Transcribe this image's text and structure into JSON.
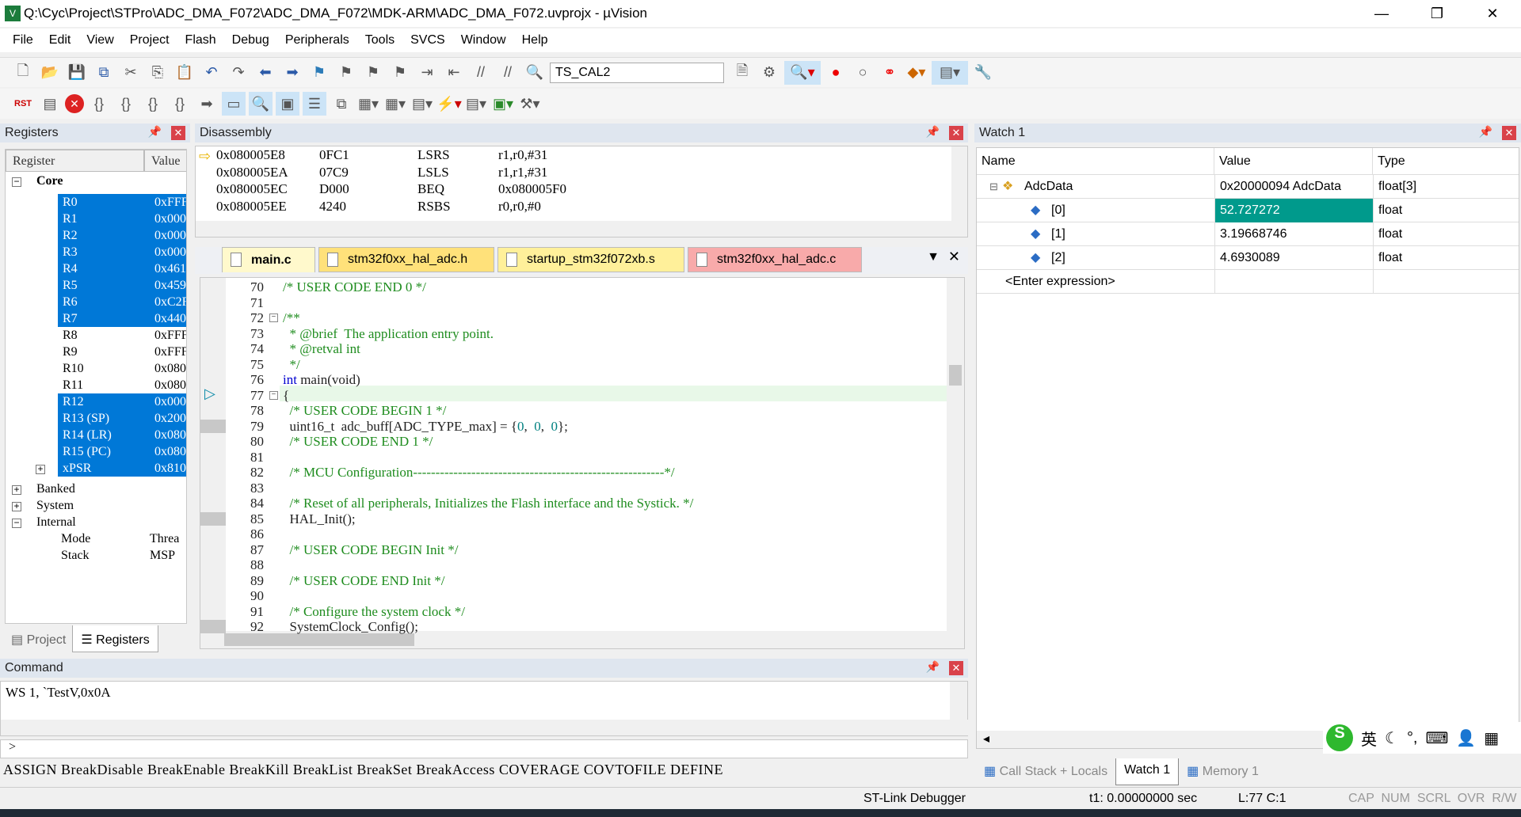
{
  "window": {
    "title": "Q:\\Cyc\\Project\\STPro\\ADC_DMA_F072\\ADC_DMA_F072\\MDK-ARM\\ADC_DMA_F072.uvprojx - µVision",
    "minimize": "—",
    "maximize": "❐",
    "close": "✕"
  },
  "menu": [
    "File",
    "Edit",
    "View",
    "Project",
    "Flash",
    "Debug",
    "Peripherals",
    "Tools",
    "SVCS",
    "Window",
    "Help"
  ],
  "toolbar": {
    "target": "TS_CAL2"
  },
  "registers": {
    "title": "Registers",
    "col_register": "Register",
    "col_value": "Value",
    "core": "Core",
    "rows": [
      {
        "name": "R0",
        "value": "0xFFF",
        "sel": true
      },
      {
        "name": "R1",
        "value": "0x000",
        "sel": true
      },
      {
        "name": "R2",
        "value": "0x000",
        "sel": true
      },
      {
        "name": "R3",
        "value": "0x000",
        "sel": true
      },
      {
        "name": "R4",
        "value": "0x461",
        "sel": true
      },
      {
        "name": "R5",
        "value": "0x459",
        "sel": true
      },
      {
        "name": "R6",
        "value": "0xC2F",
        "sel": true
      },
      {
        "name": "R7",
        "value": "0x440",
        "sel": true
      },
      {
        "name": "R8",
        "value": "0xFFF",
        "sel": false
      },
      {
        "name": "R9",
        "value": "0xFFF",
        "sel": false
      },
      {
        "name": "R10",
        "value": "0x080",
        "sel": false
      },
      {
        "name": "R11",
        "value": "0x080",
        "sel": false
      },
      {
        "name": "R12",
        "value": "0x000",
        "sel": true
      },
      {
        "name": "R13 (SP)",
        "value": "0x200",
        "sel": true
      },
      {
        "name": "R14 (LR)",
        "value": "0x080",
        "sel": true
      },
      {
        "name": "R15 (PC)",
        "value": "0x080",
        "sel": true
      },
      {
        "name": "xPSR",
        "value": "0x810",
        "sel": true
      }
    ],
    "groups": [
      "Banked",
      "System",
      "Internal"
    ],
    "internal": [
      {
        "name": "Mode",
        "value": "Threa"
      },
      {
        "name": "Stack",
        "value": "MSP"
      }
    ],
    "tab_project": "Project",
    "tab_registers": "Registers"
  },
  "disassembly": {
    "title": "Disassembly",
    "rows": [
      {
        "addr": "0x080005E8",
        "op": "0FC1",
        "mn": "LSRS",
        "args": "r1,r0,#31"
      },
      {
        "addr": "0x080005EA",
        "op": "07C9",
        "mn": "LSLS",
        "args": "r1,r1,#31"
      },
      {
        "addr": "0x080005EC",
        "op": "D000",
        "mn": "BEQ",
        "args": "0x080005F0"
      },
      {
        "addr": "0x080005EE",
        "op": "4240",
        "mn": "RSBS",
        "args": "r0,r0,#0"
      }
    ]
  },
  "editor": {
    "tabs": [
      {
        "label": "main.c",
        "bg": "#fff9cc"
      },
      {
        "label": "stm32f0xx_hal_adc.h",
        "bg": "#ffe17a"
      },
      {
        "label": "startup_stm32f072xb.s",
        "bg": "#fff09a"
      },
      {
        "label": "stm32f0xx_hal_adc.c",
        "bg": "#f8aaaa"
      }
    ],
    "lines": [
      {
        "n": "70",
        "s": [
          [
            "/* USER CODE END 0 */",
            "c-com"
          ]
        ]
      },
      {
        "n": "71",
        "s": []
      },
      {
        "n": "72",
        "s": [
          [
            "/**",
            "c-com"
          ]
        ]
      },
      {
        "n": "73",
        "s": [
          [
            "  * @brief  The application entry point.",
            "c-com"
          ]
        ]
      },
      {
        "n": "74",
        "s": [
          [
            "  * @retval int",
            "c-com"
          ]
        ]
      },
      {
        "n": "75",
        "s": [
          [
            "  */",
            "c-com"
          ]
        ]
      },
      {
        "n": "76",
        "s": [
          [
            "int ",
            "c-kw"
          ],
          [
            "main(void)",
            "c-txt"
          ]
        ]
      },
      {
        "n": "77",
        "s": [
          [
            "{",
            "c-txt"
          ]
        ]
      },
      {
        "n": "78",
        "s": [
          [
            "  /* USER CODE BEGIN 1 */",
            "c-com"
          ]
        ]
      },
      {
        "n": "79",
        "s": [
          [
            "  uint16_t  adc_buff[ADC_TYPE_max] = {",
            "c-txt"
          ],
          [
            "0",
            "c-num"
          ],
          [
            ",  ",
            "c-txt"
          ],
          [
            "0",
            "c-num"
          ],
          [
            ",  ",
            "c-txt"
          ],
          [
            "0",
            "c-num"
          ],
          [
            "};",
            "c-txt"
          ]
        ]
      },
      {
        "n": "80",
        "s": [
          [
            "  /* USER CODE END 1 */",
            "c-com"
          ]
        ]
      },
      {
        "n": "81",
        "s": []
      },
      {
        "n": "82",
        "s": [
          [
            "  /* MCU Configuration--------------------------------------------------------*/",
            "c-com"
          ]
        ]
      },
      {
        "n": "83",
        "s": []
      },
      {
        "n": "84",
        "s": [
          [
            "  /* Reset of all peripherals, Initializes the Flash interface and the Systick. */",
            "c-com"
          ]
        ]
      },
      {
        "n": "85",
        "s": [
          [
            "  HAL_Init();",
            "c-txt"
          ]
        ]
      },
      {
        "n": "86",
        "s": []
      },
      {
        "n": "87",
        "s": [
          [
            "  /* USER CODE BEGIN Init */",
            "c-com"
          ]
        ]
      },
      {
        "n": "88",
        "s": []
      },
      {
        "n": "89",
        "s": [
          [
            "  /* USER CODE END Init */",
            "c-com"
          ]
        ]
      },
      {
        "n": "90",
        "s": []
      },
      {
        "n": "91",
        "s": [
          [
            "  /* Configure the system clock */",
            "c-com"
          ]
        ]
      },
      {
        "n": "92",
        "s": [
          [
            "  SystemClock_Config();",
            "c-txt"
          ]
        ]
      }
    ]
  },
  "watch": {
    "title": "Watch 1",
    "col_name": "Name",
    "col_value": "Value",
    "col_type": "Type",
    "rows": [
      {
        "name": "AdcData",
        "value": "0x20000094 AdcData",
        "type": "float[3]"
      },
      {
        "name": "[0]",
        "value": "52.727272",
        "type": "float"
      },
      {
        "name": "[1]",
        "value": "3.19668746",
        "type": "float"
      },
      {
        "name": "[2]",
        "value": "4.6930089",
        "type": "float"
      }
    ],
    "enter": "<Enter expression>",
    "tabs": [
      "Call Stack + Locals",
      "Watch 1",
      "Memory 1"
    ]
  },
  "command": {
    "title": "Command",
    "output": "WS 1, `TestV,0x0A",
    "prompt": ">",
    "keywords": "ASSIGN BreakDisable BreakEnable BreakKill BreakList BreakSet BreakAccess COVERAGE COVTOFILE DEFINE"
  },
  "status": {
    "debugger": "ST-Link Debugger",
    "time": "t1: 0.00000000 sec",
    "pos": "L:77 C:1",
    "flags": "CAP  NUM  SCRL  OVR  R/W"
  },
  "ime": {
    "lang": "英"
  },
  "colors": {
    "selection": "#0078d7",
    "watch_highlight": "#009a8c",
    "comment": "#1e8c1e"
  }
}
